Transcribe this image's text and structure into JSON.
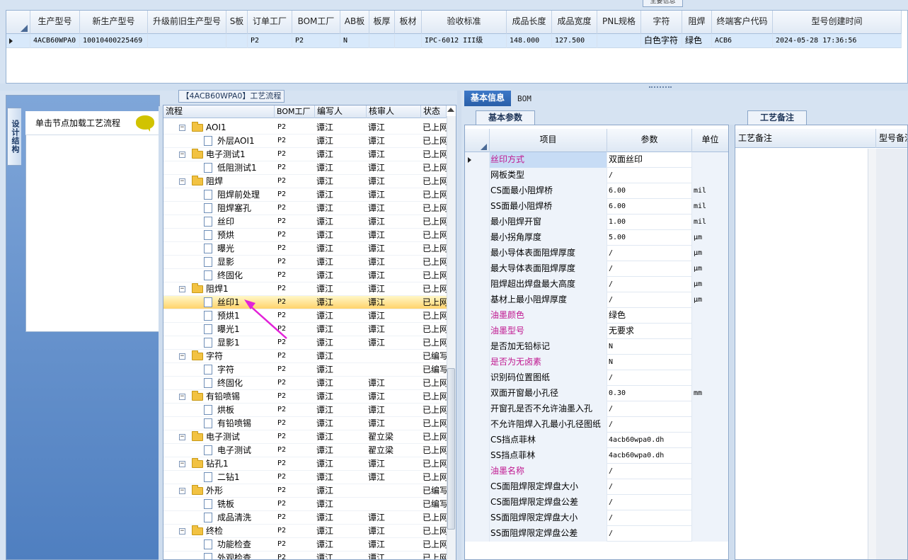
{
  "top_table": {
    "caption": "主要信息",
    "columns": [
      {
        "label": "",
        "w": 34
      },
      {
        "label": "生产型号",
        "w": 70
      },
      {
        "label": "新生产型号",
        "w": 96
      },
      {
        "label": "升级前旧生产型号",
        "w": 111
      },
      {
        "label": "S板",
        "w": 30
      },
      {
        "label": "订单工厂",
        "w": 63
      },
      {
        "label": "BOM工厂",
        "w": 68
      },
      {
        "label": "AB板",
        "w": 41
      },
      {
        "label": "板厚",
        "w": 36
      },
      {
        "label": "板材",
        "w": 38
      },
      {
        "label": "验收标准",
        "w": 120
      },
      {
        "label": "成品长度",
        "w": 64
      },
      {
        "label": "成品宽度",
        "w": 64
      },
      {
        "label": "PNL规格",
        "w": 62
      },
      {
        "label": "字符",
        "w": 58
      },
      {
        "label": "阻焊",
        "w": 42
      },
      {
        "label": "终端客户代码",
        "w": 86
      },
      {
        "label": "型号创建时间",
        "w": 182
      }
    ],
    "row": [
      "",
      "4ACB60WPA0",
      "10010400225469",
      "",
      "",
      "P2",
      "P2",
      "N",
      "",
      "",
      "IPC-6012 III级",
      "148.000",
      "127.500",
      "",
      "白色字符",
      "绿色",
      "ACB6",
      "2024-05-28 17:36:56"
    ]
  },
  "left_panel": {
    "vertical_tab": "设计结构",
    "hint": "单击节点加载工艺流程"
  },
  "tree": {
    "caption": "【4ACB60WPA0】工艺流程",
    "headers": [
      "流程",
      "BOM工厂",
      "编写人",
      "核审人",
      "状态"
    ],
    "rows": [
      {
        "level": 0,
        "name": "AOI1",
        "bom": "P2",
        "writer": "谭江",
        "reviewer": "谭江",
        "status": "已上网"
      },
      {
        "level": 1,
        "name": "外层AOI1",
        "bom": "P2",
        "writer": "谭江",
        "reviewer": "谭江",
        "status": "已上网"
      },
      {
        "level": 0,
        "name": "电子测试1",
        "bom": "P2",
        "writer": "谭江",
        "reviewer": "谭江",
        "status": "已上网"
      },
      {
        "level": 1,
        "name": "低阻测试1",
        "bom": "P2",
        "writer": "谭江",
        "reviewer": "谭江",
        "status": "已上网"
      },
      {
        "level": 0,
        "name": "阻焊",
        "bom": "P2",
        "writer": "谭江",
        "reviewer": "谭江",
        "status": "已上网"
      },
      {
        "level": 1,
        "name": "阻焊前处理",
        "bom": "P2",
        "writer": "谭江",
        "reviewer": "谭江",
        "status": "已上网"
      },
      {
        "level": 1,
        "name": "阻焊塞孔",
        "bom": "P2",
        "writer": "谭江",
        "reviewer": "谭江",
        "status": "已上网"
      },
      {
        "level": 1,
        "name": "丝印",
        "bom": "P2",
        "writer": "谭江",
        "reviewer": "谭江",
        "status": "已上网"
      },
      {
        "level": 1,
        "name": "预烘",
        "bom": "P2",
        "writer": "谭江",
        "reviewer": "谭江",
        "status": "已上网"
      },
      {
        "level": 1,
        "name": "曝光",
        "bom": "P2",
        "writer": "谭江",
        "reviewer": "谭江",
        "status": "已上网"
      },
      {
        "level": 1,
        "name": "显影",
        "bom": "P2",
        "writer": "谭江",
        "reviewer": "谭江",
        "status": "已上网"
      },
      {
        "level": 1,
        "name": "终固化",
        "bom": "P2",
        "writer": "谭江",
        "reviewer": "谭江",
        "status": "已上网"
      },
      {
        "level": 0,
        "name": "阻焊1",
        "bom": "P2",
        "writer": "谭江",
        "reviewer": "谭江",
        "status": "已上网"
      },
      {
        "level": 1,
        "name": "丝印1",
        "bom": "P2",
        "writer": "谭江",
        "reviewer": "谭江",
        "status": "已上网",
        "selected": true
      },
      {
        "level": 1,
        "name": "预烘1",
        "bom": "P2",
        "writer": "谭江",
        "reviewer": "谭江",
        "status": "已上网"
      },
      {
        "level": 1,
        "name": "曝光1",
        "bom": "P2",
        "writer": "谭江",
        "reviewer": "谭江",
        "status": "已上网"
      },
      {
        "level": 1,
        "name": "显影1",
        "bom": "P2",
        "writer": "谭江",
        "reviewer": "谭江",
        "status": "已上网"
      },
      {
        "level": 0,
        "name": "字符",
        "bom": "P2",
        "writer": "谭江",
        "reviewer": "",
        "status": "已编写"
      },
      {
        "level": 1,
        "name": "字符",
        "bom": "P2",
        "writer": "谭江",
        "reviewer": "",
        "status": "已编写"
      },
      {
        "level": 1,
        "name": "终固化",
        "bom": "P2",
        "writer": "谭江",
        "reviewer": "谭江",
        "status": "已上网"
      },
      {
        "level": 0,
        "name": "有铅喷锡",
        "bom": "P2",
        "writer": "谭江",
        "reviewer": "谭江",
        "status": "已上网"
      },
      {
        "level": 1,
        "name": "烘板",
        "bom": "P2",
        "writer": "谭江",
        "reviewer": "谭江",
        "status": "已上网"
      },
      {
        "level": 1,
        "name": "有铅喷锡",
        "bom": "P2",
        "writer": "谭江",
        "reviewer": "谭江",
        "status": "已上网"
      },
      {
        "level": 0,
        "name": "电子测试",
        "bom": "P2",
        "writer": "谭江",
        "reviewer": "翟立梁",
        "status": "已上网"
      },
      {
        "level": 1,
        "name": "电子测试",
        "bom": "P2",
        "writer": "谭江",
        "reviewer": "翟立梁",
        "status": "已上网"
      },
      {
        "level": 0,
        "name": "钻孔1",
        "bom": "P2",
        "writer": "谭江",
        "reviewer": "谭江",
        "status": "已上网"
      },
      {
        "level": 1,
        "name": "二钻1",
        "bom": "P2",
        "writer": "谭江",
        "reviewer": "谭江",
        "status": "已上网"
      },
      {
        "level": 0,
        "name": "外形",
        "bom": "P2",
        "writer": "谭江",
        "reviewer": "",
        "status": "已编写"
      },
      {
        "level": 1,
        "name": "铣板",
        "bom": "P2",
        "writer": "谭江",
        "reviewer": "",
        "status": "已编写"
      },
      {
        "level": 1,
        "name": "成品清洗",
        "bom": "P2",
        "writer": "谭江",
        "reviewer": "谭江",
        "status": "已上网"
      },
      {
        "level": 0,
        "name": "终检",
        "bom": "P2",
        "writer": "谭江",
        "reviewer": "谭江",
        "status": "已上网"
      },
      {
        "level": 1,
        "name": "功能检查",
        "bom": "P2",
        "writer": "谭江",
        "reviewer": "谭江",
        "status": "已上网"
      },
      {
        "level": 1,
        "name": "外观检查",
        "bom": "P2",
        "writer": "谭江",
        "reviewer": "谭江",
        "status": "已上网"
      }
    ]
  },
  "right": {
    "tabs": [
      "基本信息",
      "BOM"
    ],
    "params_tab": "基本参数",
    "notes_tab": "工艺备注",
    "param_headers": [
      "项目",
      "参数",
      "单位"
    ],
    "params": [
      {
        "name": "丝印方式",
        "value": "双面丝印",
        "unit": "",
        "magenta": true,
        "selected": true
      },
      {
        "name": "网板类型",
        "value": "/",
        "unit": ""
      },
      {
        "name": "CS面最小阻焊桥",
        "value": "6.00",
        "unit": "mil"
      },
      {
        "name": "SS面最小阻焊桥",
        "value": "6.00",
        "unit": "mil"
      },
      {
        "name": "最小阻焊开窗",
        "value": "1.00",
        "unit": "mil"
      },
      {
        "name": "最小拐角厚度",
        "value": "5.00",
        "unit": "μm"
      },
      {
        "name": "最小导体表面阻焊厚度",
        "value": "/",
        "unit": "μm"
      },
      {
        "name": "最大导体表面阻焊厚度",
        "value": "/",
        "unit": "μm"
      },
      {
        "name": "阻焊超出焊盘最大高度",
        "value": "/",
        "unit": "μm"
      },
      {
        "name": "基材上最小阻焊厚度",
        "value": "/",
        "unit": "μm"
      },
      {
        "name": "油墨颜色",
        "value": "绿色",
        "unit": "",
        "magenta": true
      },
      {
        "name": "油墨型号",
        "value": "无要求",
        "unit": "",
        "magenta": true
      },
      {
        "name": "是否加无铅标记",
        "value": "N",
        "unit": ""
      },
      {
        "name": "是否为无卤素",
        "value": "N",
        "unit": "",
        "magenta": true
      },
      {
        "name": "识别码位置图纸",
        "value": "/",
        "unit": ""
      },
      {
        "name": "双面开窗最小孔径",
        "value": "0.30",
        "unit": "mm"
      },
      {
        "name": "开窗孔是否不允许油墨入孔",
        "value": "/",
        "unit": ""
      },
      {
        "name": "不允许阻焊入孔最小孔径图纸",
        "value": "/",
        "unit": ""
      },
      {
        "name": "CS挡点菲林",
        "value": "4acb60wpa0.dh",
        "unit": ""
      },
      {
        "name": "SS挡点菲林",
        "value": "4acb60wpa0.dh",
        "unit": ""
      },
      {
        "name": "油墨名称",
        "value": "/",
        "unit": "",
        "magenta": true
      },
      {
        "name": "CS面阻焊限定焊盘大小",
        "value": "/",
        "unit": ""
      },
      {
        "name": "CS面阻焊限定焊盘公差",
        "value": "/",
        "unit": ""
      },
      {
        "name": "SS面阻焊限定焊盘大小",
        "value": "/",
        "unit": ""
      },
      {
        "name": "SS面阻焊限定焊盘公差",
        "value": "/",
        "unit": ""
      }
    ],
    "notes_headers": [
      "工艺备注",
      "型号备注"
    ]
  }
}
